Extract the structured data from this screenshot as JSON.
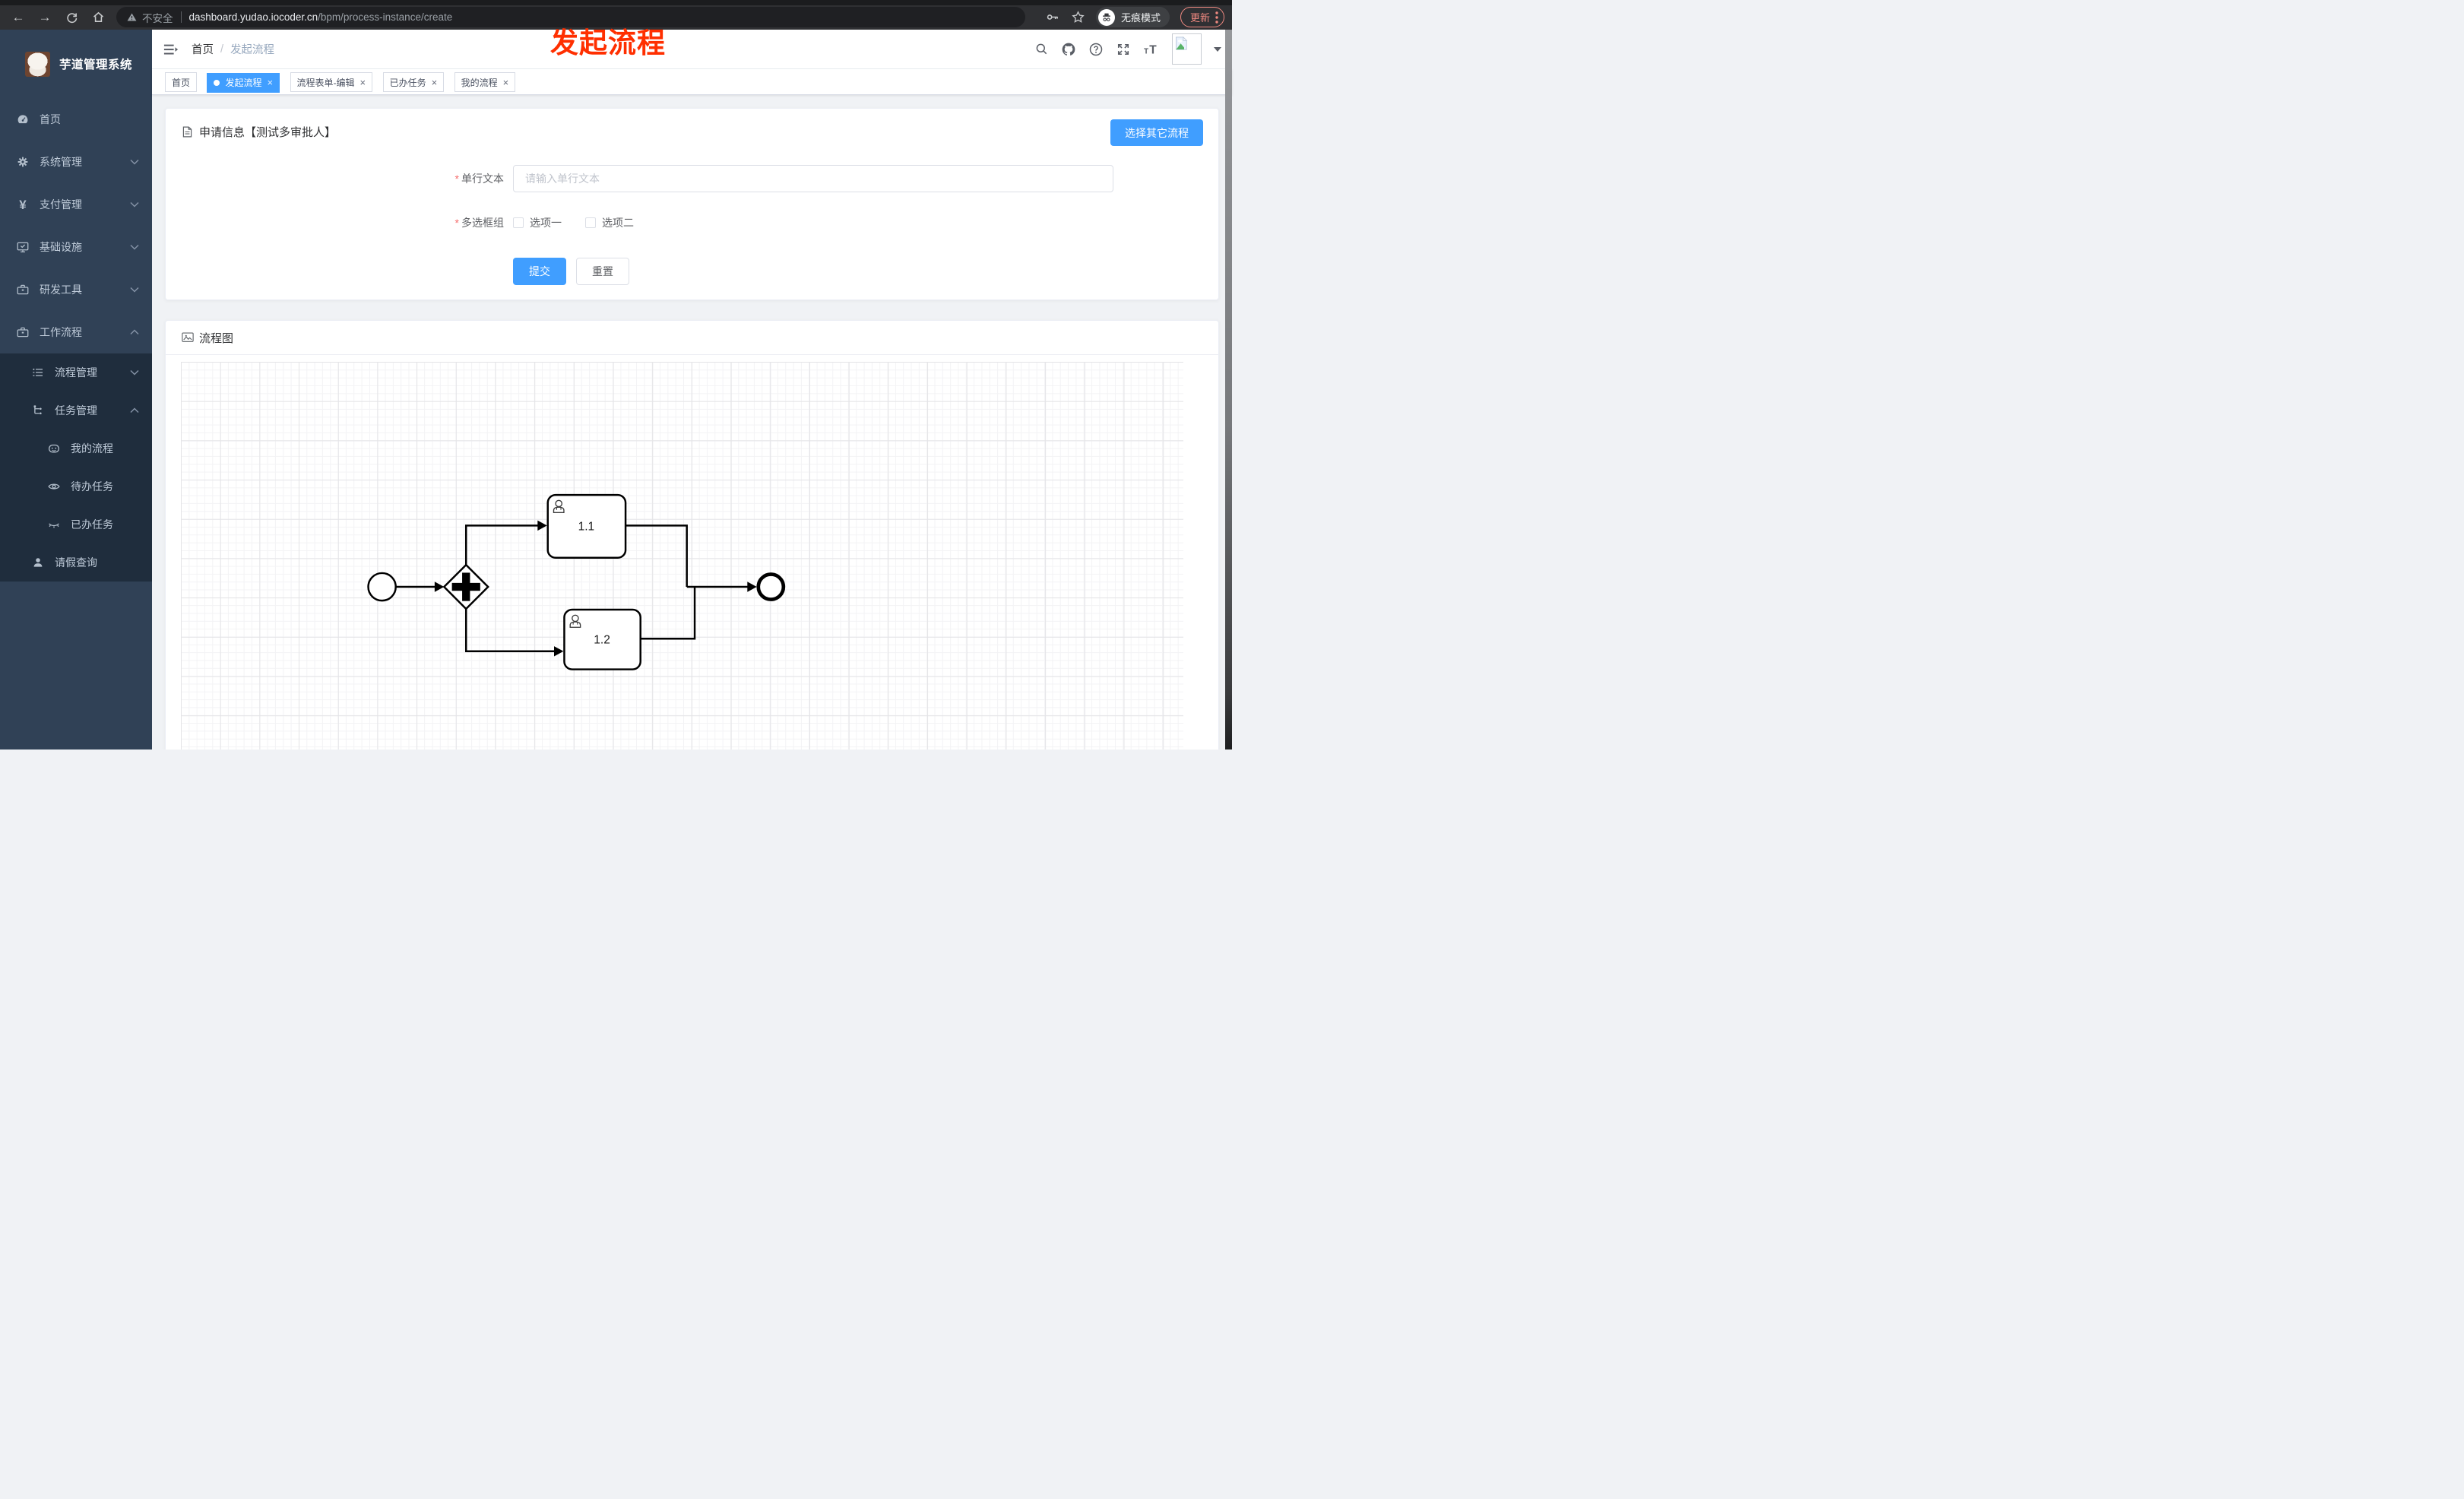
{
  "browser": {
    "security_label": "不安全",
    "url_host": "dashboard.yudao.iocoder.cn",
    "url_path": "/bpm/process-instance/create",
    "incognito_label": "无痕模式",
    "update_label": "更新"
  },
  "annotation": {
    "text": "发起流程"
  },
  "sidebar": {
    "app_title": "芋道管理系统",
    "menu": [
      {
        "label": "首页"
      },
      {
        "label": "系统管理"
      },
      {
        "label": "支付管理"
      },
      {
        "label": "基础设施"
      },
      {
        "label": "研发工具"
      },
      {
        "label": "工作流程"
      },
      {
        "label": "流程管理"
      },
      {
        "label": "任务管理"
      },
      {
        "label": "我的流程"
      },
      {
        "label": "待办任务"
      },
      {
        "label": "已办任务"
      },
      {
        "label": "请假查询"
      }
    ]
  },
  "breadcrumb": {
    "items": [
      "首页",
      "发起流程"
    ],
    "separator": "/"
  },
  "tabs": [
    {
      "label": "首页"
    },
    {
      "label": "发起流程",
      "close": "×"
    },
    {
      "label": "流程表单-编辑",
      "close": "×"
    },
    {
      "label": "已办任务",
      "close": "×"
    },
    {
      "label": "我的流程",
      "close": "×"
    }
  ],
  "apply_card": {
    "title": "申请信息【测试多审批人】",
    "choose_other_label": "选择其它流程",
    "field_text": {
      "label": "单行文本",
      "required_mark": "*",
      "placeholder": "请输入单行文本",
      "value": ""
    },
    "field_checkbox": {
      "label": "多选框组",
      "required_mark": "*",
      "options": [
        {
          "label": "选项一"
        },
        {
          "label": "选项二"
        }
      ]
    },
    "submit_label": "提交",
    "reset_label": "重置"
  },
  "diagram_card": {
    "title": "流程图",
    "tasks": [
      {
        "label": "1.1"
      },
      {
        "label": "1.2"
      }
    ]
  },
  "colors": {
    "accent_blue": "#409eff",
    "sidebar_bg": "#304156",
    "sidebar_submenu_bg": "#1f2d3d",
    "annotation_red": "#ff2f00",
    "update_pill_red": "#ef8980",
    "required_red": "#f56c6c"
  }
}
